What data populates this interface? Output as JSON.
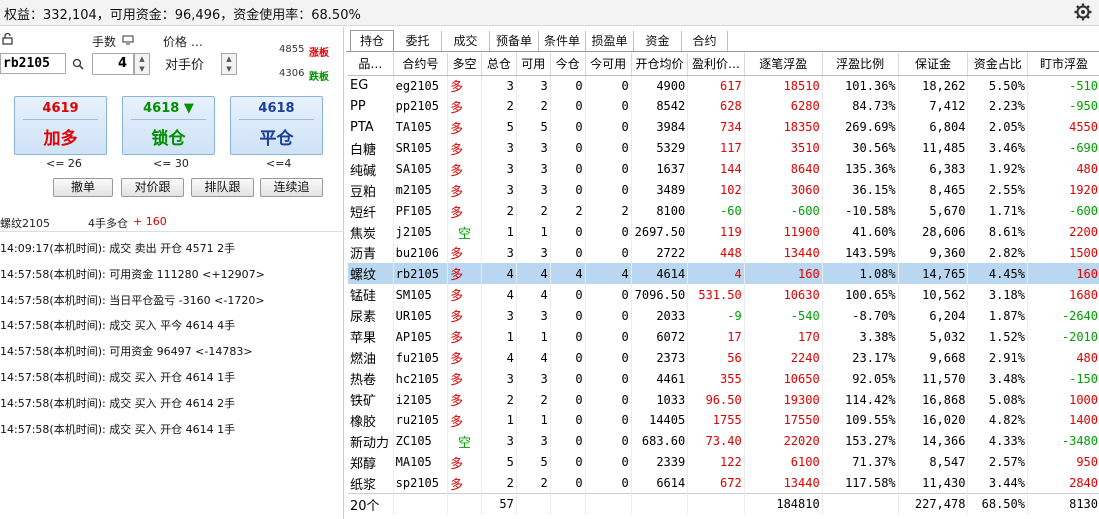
{
  "topbar": {
    "summary": "权益：332,104，可用资金：96,496，资金使用率：68.50%"
  },
  "order_panel": {
    "lock_icon": "lock-icon",
    "qty_label": "手数",
    "price_label": "价格 …",
    "symbol": "rb2105",
    "qty": "4",
    "price_mode": "对手价",
    "limit_up_price": "4855",
    "limit_up_label": "涨板",
    "limit_down_price": "4306",
    "limit_down_label": "跌板",
    "buttons": [
      {
        "price": "4619",
        "action": "加多",
        "note": "<= 26",
        "price_color": "#e00000",
        "action_color": "#e00000"
      },
      {
        "price": "4618 ▼",
        "action": "锁仓",
        "note": "<= 30",
        "price_color": "#009000",
        "action_color": "#009000"
      },
      {
        "price": "4618",
        "action": "平仓",
        "note": "<=4",
        "price_color": "#1a3e9c",
        "action_color": "#1a3e9c"
      }
    ],
    "small_buttons": [
      "撤单",
      "对价跟",
      "排队跟",
      "连续追"
    ]
  },
  "position_line": {
    "name": "螺纹2105",
    "info": "4手多仓",
    "pnl": "+ 160"
  },
  "log": [
    "14:09:17(本机时间): 成交  卖出  开仓  4571  2手",
    "14:57:58(本机时间): 可用资金 111280  <+12907>",
    "14:57:58(本机时间): 当日平仓盈亏 -3160  <-1720>",
    "14:57:58(本机时间): 成交  买入  平今  4614  4手",
    "14:57:58(本机时间): 可用资金 96497  <-14783>",
    "14:57:58(本机时间): 成交  买入  开仓  4614  1手",
    "14:57:58(本机时间): 成交  买入  开仓  4614  2手",
    "14:57:58(本机时间): 成交  买入  开仓  4614  1手"
  ],
  "tabs": [
    "持仓",
    "委托",
    "成交",
    "预备单",
    "条件单",
    "损盈单",
    "资金",
    "合约"
  ],
  "active_tab": "持仓",
  "table": {
    "headers": [
      "品…",
      "合约号",
      "多空",
      "总仓",
      "可用",
      "今仓",
      "今可用",
      "开仓均价",
      "盈利价…",
      "逐笔浮盈",
      "浮盈比例",
      "保证金",
      "资金占比",
      "盯市浮盈"
    ],
    "rows": [
      [
        "EG",
        "eg2105",
        "多",
        "3",
        "3",
        "0",
        "0",
        "4900",
        "617",
        "18510",
        "101.36%",
        "18,262",
        "5.50%",
        "-510"
      ],
      [
        "PP",
        "pp2105",
        "多",
        "2",
        "2",
        "0",
        "0",
        "8542",
        "628",
        "6280",
        "84.73%",
        "7,412",
        "2.23%",
        "-950"
      ],
      [
        "PTA",
        "TA105",
        "多",
        "5",
        "5",
        "0",
        "0",
        "3984",
        "734",
        "18350",
        "269.69%",
        "6,804",
        "2.05%",
        "4550"
      ],
      [
        "白糖",
        "SR105",
        "多",
        "3",
        "3",
        "0",
        "0",
        "5329",
        "117",
        "3510",
        "30.56%",
        "11,485",
        "3.46%",
        "-690"
      ],
      [
        "纯碱",
        "SA105",
        "多",
        "3",
        "3",
        "0",
        "0",
        "1637",
        "144",
        "8640",
        "135.36%",
        "6,383",
        "1.92%",
        "480"
      ],
      [
        "豆粕",
        "m2105",
        "多",
        "3",
        "3",
        "0",
        "0",
        "3489",
        "102",
        "3060",
        "36.15%",
        "8,465",
        "2.55%",
        "1920"
      ],
      [
        "短纤",
        "PF105",
        "多",
        "2",
        "2",
        "2",
        "2",
        "8100",
        "-60",
        "-600",
        "-10.58%",
        "5,670",
        "1.71%",
        "-600"
      ],
      [
        "焦炭",
        "j2105",
        "空",
        "1",
        "1",
        "0",
        "0",
        "2697.50",
        "119",
        "11900",
        "41.60%",
        "28,606",
        "8.61%",
        "2200"
      ],
      [
        "沥青",
        "bu2106",
        "多",
        "3",
        "3",
        "0",
        "0",
        "2722",
        "448",
        "13440",
        "143.59%",
        "9,360",
        "2.82%",
        "1500"
      ],
      [
        "螺纹",
        "rb2105",
        "多",
        "4",
        "4",
        "4",
        "4",
        "4614",
        "4",
        "160",
        "1.08%",
        "14,765",
        "4.45%",
        "160"
      ],
      [
        "锰硅",
        "SM105",
        "多",
        "4",
        "4",
        "0",
        "0",
        "7096.50",
        "531.50",
        "10630",
        "100.65%",
        "10,562",
        "3.18%",
        "1680"
      ],
      [
        "尿素",
        "UR105",
        "多",
        "3",
        "3",
        "0",
        "0",
        "2033",
        "-9",
        "-540",
        "-8.70%",
        "6,204",
        "1.87%",
        "-2640"
      ],
      [
        "苹果",
        "AP105",
        "多",
        "1",
        "1",
        "0",
        "0",
        "6072",
        "17",
        "170",
        "3.38%",
        "5,032",
        "1.52%",
        "-2010"
      ],
      [
        "燃油",
        "fu2105",
        "多",
        "4",
        "4",
        "0",
        "0",
        "2373",
        "56",
        "2240",
        "23.17%",
        "9,668",
        "2.91%",
        "480"
      ],
      [
        "热卷",
        "hc2105",
        "多",
        "3",
        "3",
        "0",
        "0",
        "4461",
        "355",
        "10650",
        "92.05%",
        "11,570",
        "3.48%",
        "-150"
      ],
      [
        "铁矿",
        "i2105",
        "多",
        "2",
        "2",
        "0",
        "0",
        "1033",
        "96.50",
        "19300",
        "114.42%",
        "16,868",
        "5.08%",
        "1000"
      ],
      [
        "橡胶",
        "ru2105",
        "多",
        "1",
        "1",
        "0",
        "0",
        "14405",
        "1755",
        "17550",
        "109.55%",
        "16,020",
        "4.82%",
        "1400"
      ],
      [
        "新动力",
        "ZC105",
        "空",
        "3",
        "3",
        "0",
        "0",
        "683.60",
        "73.40",
        "22020",
        "153.27%",
        "14,366",
        "4.33%",
        "-3480"
      ],
      [
        "郑醇",
        "MA105",
        "多",
        "5",
        "5",
        "0",
        "0",
        "2339",
        "122",
        "6100",
        "71.37%",
        "8,547",
        "2.57%",
        "950"
      ],
      [
        "纸浆",
        "sp2105",
        "多",
        "2",
        "2",
        "0",
        "0",
        "6614",
        "672",
        "13440",
        "117.58%",
        "11,430",
        "3.44%",
        "2840"
      ]
    ],
    "footer": [
      "20个",
      "",
      "",
      "57",
      "",
      "",
      "",
      "",
      "",
      "184810",
      "",
      "227,478",
      "68.50%",
      "8130"
    ],
    "selected_row": 9
  },
  "colors": {
    "up": "#e00000",
    "down": "#00a000",
    "selected": "#b9d7f1"
  }
}
